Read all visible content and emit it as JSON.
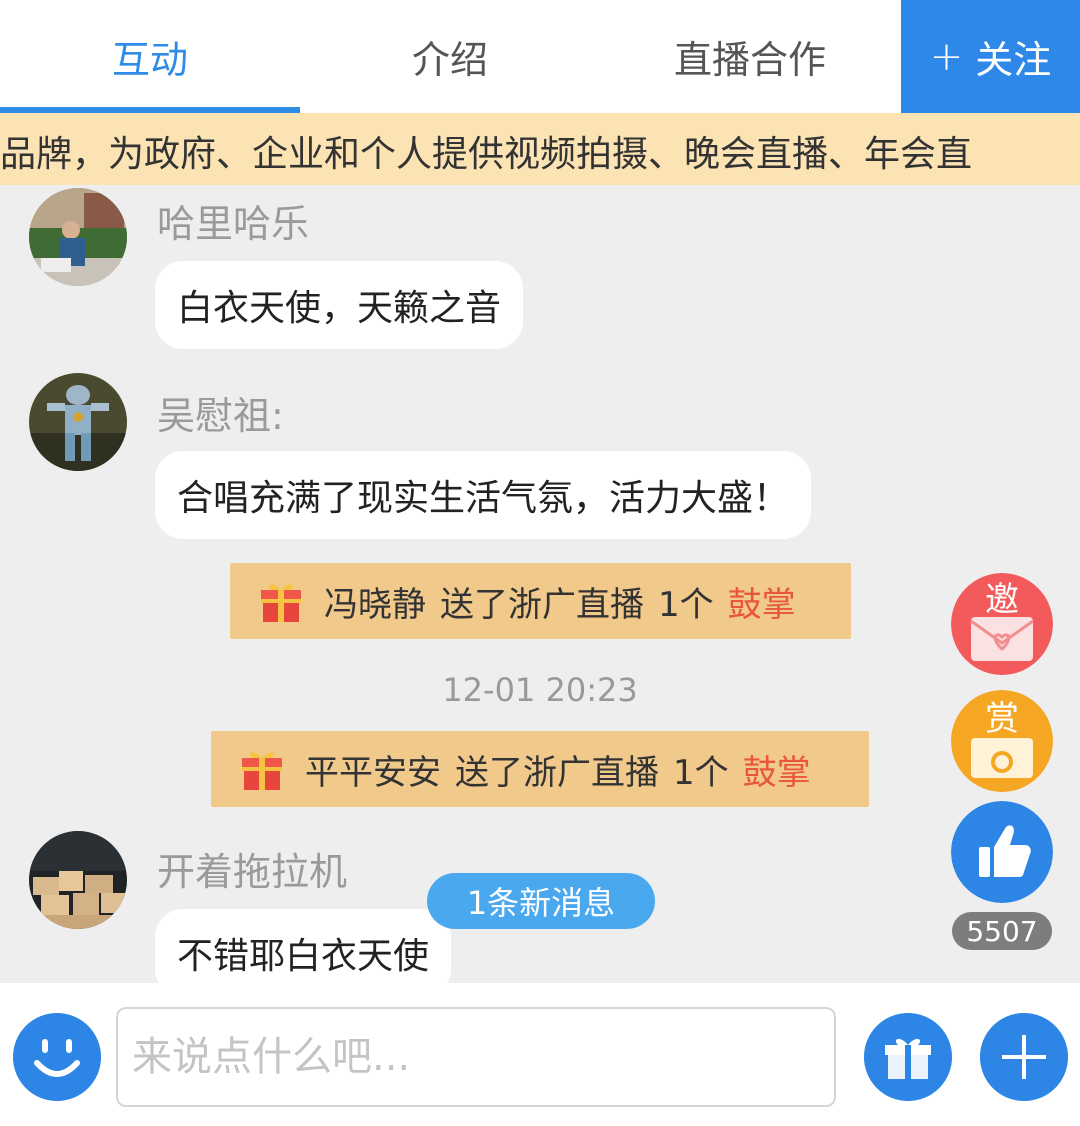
{
  "tabs": [
    {
      "label": "互动",
      "active": true
    },
    {
      "label": "介绍",
      "active": false
    },
    {
      "label": "直播合作",
      "active": false
    }
  ],
  "follow": {
    "plus": "+",
    "label": "关注"
  },
  "banner": {
    "text": "播品牌，为政府、企业和个人提供视频拍摄、晚会直播、年会直"
  },
  "messages": [
    {
      "user": "哈里哈乐",
      "text": "白衣天使，天籁之音",
      "avatar": "photo-child-avatar"
    },
    {
      "user": "吴慰祖:",
      "text": "合唱充满了现实生活气氛，活力大盛！",
      "avatar": "robot-figure-avatar"
    },
    {
      "user": "开着拖拉机",
      "text": "不错耶白衣天使",
      "avatar": "wood-blocks-avatar"
    }
  ],
  "gifts": [
    {
      "user": "冯晓静",
      "action": "送了浙广直播",
      "count": "1个",
      "gift": "鼓掌"
    },
    {
      "user": "平平安安",
      "action": "送了浙广直播",
      "count": "1个",
      "gift": "鼓掌"
    }
  ],
  "timestamp": "12-01 20:23",
  "new_message": "1条新消息",
  "side": {
    "invite_label": "邀",
    "reward_label": "赏",
    "like_count": "5507"
  },
  "composer": {
    "placeholder": "来说点什么吧..."
  },
  "colors": {
    "accent": "#2e88e8",
    "banner": "#fbe3b4",
    "gift_row": "#f0c98b",
    "gift_name": "#e8573a"
  }
}
